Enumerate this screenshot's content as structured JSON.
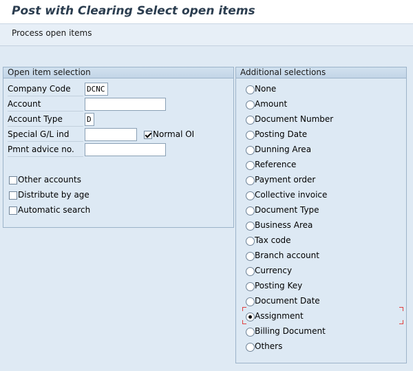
{
  "window": {
    "title": "Post with Clearing Select open items"
  },
  "toolbar": {
    "process_open_items": "Process open items"
  },
  "open_item_selection": {
    "title": "Open item selection",
    "company_code": {
      "label": "Company Code",
      "value": "DCNC"
    },
    "account": {
      "label": "Account",
      "value": ""
    },
    "account_type": {
      "label": "Account Type",
      "value": "D"
    },
    "special_gl_ind": {
      "label": "Special G/L ind",
      "value": ""
    },
    "normal_oi": {
      "label": "Normal OI",
      "checked": true
    },
    "pmnt_advice_no": {
      "label": "Pmnt advice no.",
      "value": ""
    },
    "other_accounts": {
      "label": "Other accounts",
      "checked": false
    },
    "distribute_by_age": {
      "label": "Distribute by age",
      "checked": false
    },
    "automatic_search": {
      "label": "Automatic search",
      "checked": false
    }
  },
  "additional_selections": {
    "title": "Additional selections",
    "selected": "Assignment",
    "options": [
      "None",
      "Amount",
      "Document Number",
      "Posting Date",
      "Dunning Area",
      "Reference",
      "Payment order",
      "Collective invoice",
      "Document Type",
      "Business Area",
      "Tax code",
      "Branch account",
      "Currency",
      "Posting Key",
      "Document Date",
      "Assignment",
      "Billing Document",
      "Others"
    ]
  }
}
